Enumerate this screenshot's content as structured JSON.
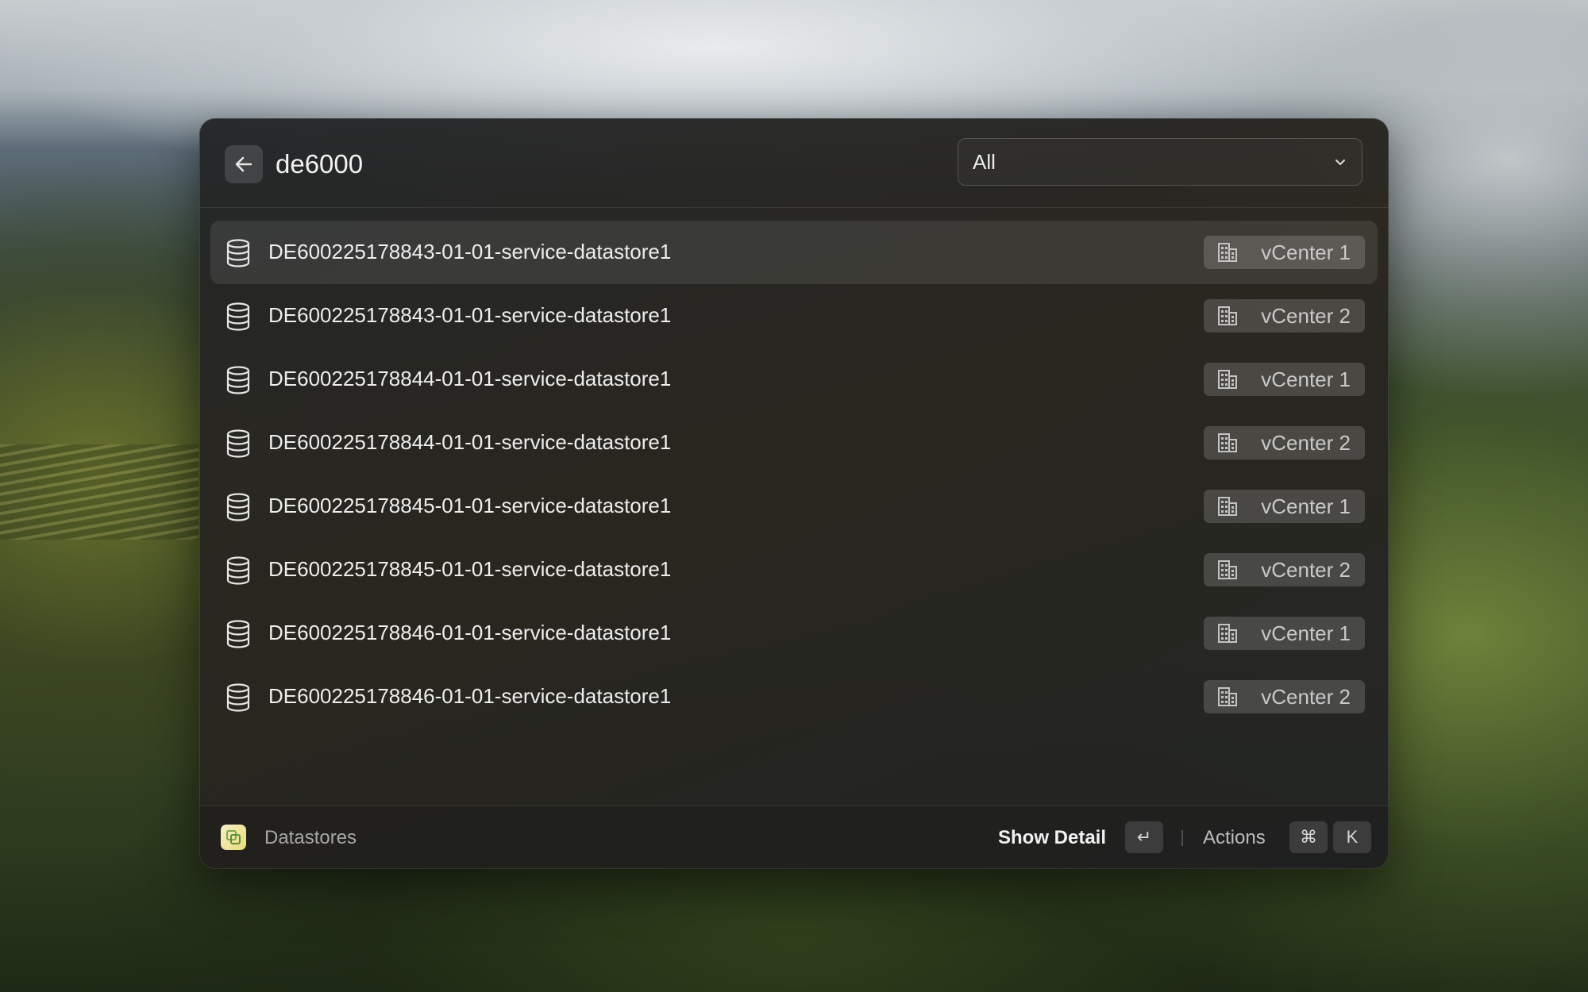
{
  "search": {
    "query": "de6000",
    "back_icon": "arrow-left-icon"
  },
  "filter": {
    "selected": "All"
  },
  "results": [
    {
      "title": "DE600225178843-01-01-service-datastore1",
      "tag": "vCenter 1"
    },
    {
      "title": "DE600225178843-01-01-service-datastore1",
      "tag": "vCenter 2"
    },
    {
      "title": "DE600225178844-01-01-service-datastore1",
      "tag": "vCenter 1"
    },
    {
      "title": "DE600225178844-01-01-service-datastore1",
      "tag": "vCenter 2"
    },
    {
      "title": "DE600225178845-01-01-service-datastore1",
      "tag": "vCenter 1"
    },
    {
      "title": "DE600225178845-01-01-service-datastore1",
      "tag": "vCenter 2"
    },
    {
      "title": "DE600225178846-01-01-service-datastore1",
      "tag": "vCenter 1"
    },
    {
      "title": "DE600225178846-01-01-service-datastore1",
      "tag": "vCenter 2"
    }
  ],
  "icons": {
    "row": "database-icon",
    "tag": "building-icon"
  },
  "footer": {
    "title": "Datastores",
    "primary_action": "Show Detail",
    "primary_key": "↵",
    "actions_label": "Actions",
    "actions_keys": [
      "⌘",
      "K"
    ]
  }
}
